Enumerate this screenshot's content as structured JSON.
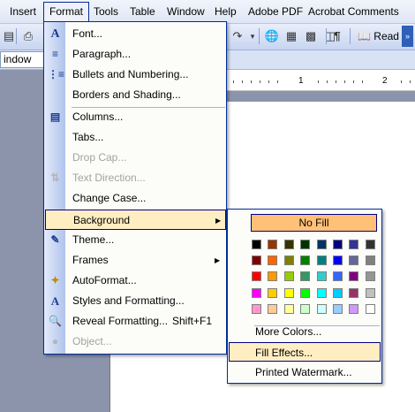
{
  "menubar": {
    "items": [
      "Insert",
      "Format",
      "Tools",
      "Table",
      "Window",
      "Help",
      "Adobe PDF",
      "Acrobat Comments"
    ]
  },
  "toolbar": {
    "read_label": "Read",
    "icons": [
      "save-icon",
      "print-icon",
      "redo-icon",
      "hyperlink-icon",
      "table-icon",
      "columns-icon",
      "paragraph-mark-icon",
      "read-book-icon"
    ]
  },
  "style_box": {
    "value": "indow"
  },
  "ruler": {
    "numbers": [
      "1",
      "2"
    ]
  },
  "format_menu": {
    "items": [
      {
        "label": "Font...",
        "icon": "font-icon",
        "enabled": true
      },
      {
        "label": "Paragraph...",
        "icon": "paragraph-icon",
        "enabled": true
      },
      {
        "label": "Bullets and Numbering...",
        "icon": "bullets-icon",
        "enabled": true
      },
      {
        "label": "Borders and Shading...",
        "icon": "",
        "enabled": true
      },
      {
        "label": "Columns...",
        "icon": "columns-icon",
        "enabled": true
      },
      {
        "label": "Tabs...",
        "icon": "",
        "enabled": true
      },
      {
        "label": "Drop Cap...",
        "icon": "",
        "enabled": false
      },
      {
        "label": "Text Direction...",
        "icon": "text-direction-icon",
        "enabled": false
      },
      {
        "label": "Change Case...",
        "icon": "",
        "enabled": true
      },
      {
        "label": "Background",
        "icon": "",
        "enabled": true,
        "submenu": true,
        "highlighted": true
      },
      {
        "label": "Theme...",
        "icon": "theme-icon",
        "enabled": true
      },
      {
        "label": "Frames",
        "icon": "",
        "enabled": true,
        "submenu": true
      },
      {
        "label": "AutoFormat...",
        "icon": "autoformat-icon",
        "enabled": true
      },
      {
        "label": "Styles and Formatting...",
        "icon": "styles-icon",
        "enabled": true
      },
      {
        "label": "Reveal Formatting...",
        "icon": "reveal-formatting-icon",
        "enabled": true,
        "shortcut": "Shift+F1"
      },
      {
        "label": "Object...",
        "icon": "object-icon",
        "enabled": false
      }
    ]
  },
  "background_menu": {
    "no_fill": "No Fill",
    "more_colors": "More Colors...",
    "fill_effects": "Fill Effects...",
    "printed_watermark": "Printed Watermark...",
    "palette": [
      [
        "#000000",
        "#993300",
        "#333300",
        "#003300",
        "#003366",
        "#000080",
        "#333399",
        "#333333"
      ],
      [
        "#800000",
        "#FF6600",
        "#808000",
        "#008000",
        "#008080",
        "#0000FF",
        "#666699",
        "#808080"
      ],
      [
        "#FF0000",
        "#FF9900",
        "#99CC00",
        "#339966",
        "#33CCCC",
        "#3366FF",
        "#800080",
        "#969696"
      ],
      [
        "#FF00FF",
        "#FFCC00",
        "#FFFF00",
        "#00FF00",
        "#00FFFF",
        "#00CCFF",
        "#993366",
        "#C0C0C0"
      ],
      [
        "#FF99CC",
        "#FFCC99",
        "#FFFF99",
        "#CCFFCC",
        "#CCFFFF",
        "#99CCFF",
        "#CC99FF",
        "#FFFFFF"
      ]
    ]
  },
  "colors": {
    "highlight": "#FFEEC2",
    "no_fill_highlight": "#FFC177",
    "menu_border": "#002D96"
  }
}
